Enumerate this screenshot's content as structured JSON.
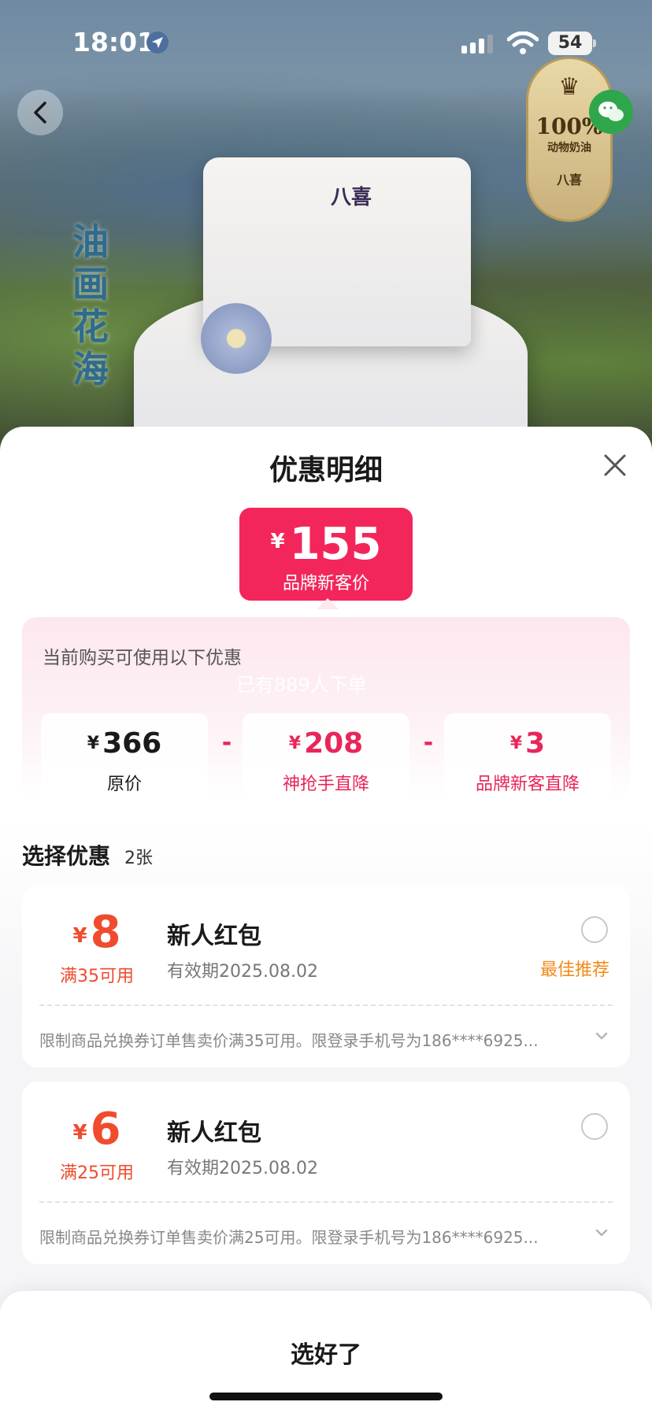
{
  "status_bar": {
    "time": "18:01",
    "battery": "54"
  },
  "hero": {
    "poem_text": "油画花海",
    "cake_logo": "八喜",
    "badge": {
      "percent": "100%",
      "subtitle": "动物奶油",
      "brand": "八喜"
    }
  },
  "sheet": {
    "title": "优惠明细",
    "price": {
      "currency": "¥",
      "amount": "155",
      "label": "品牌新客价"
    },
    "panel": {
      "hint": "当前购买可使用以下优惠",
      "watermark": "已有889人下单",
      "items": [
        {
          "currency": "¥",
          "amount": "366",
          "label": "原价"
        },
        {
          "currency": "¥",
          "amount": "208",
          "label": "神抢手直降"
        },
        {
          "currency": "¥",
          "amount": "3",
          "label": "品牌新客直降"
        }
      ],
      "operator": "-"
    },
    "section": {
      "title": "选择优惠",
      "count": "2张"
    },
    "coupons": [
      {
        "currency": "¥",
        "amount": "8",
        "condition": "满35可用",
        "name": "新人红包",
        "valid": "有效期2025.08.02",
        "tag": "最佳推荐",
        "terms": "限制商品兑换券订单售卖价满35可用。限登录手机号为186****6925..."
      },
      {
        "currency": "¥",
        "amount": "6",
        "condition": "满25可用",
        "name": "新人红包",
        "valid": "有效期2025.08.02",
        "tag": "",
        "terms": "限制商品兑换券订单售卖价满25可用。限登录手机号为186****6925..."
      }
    ],
    "confirm_label": "选好了"
  },
  "colors": {
    "price_red": "#f3265c",
    "coupon_orange": "#f04b2d",
    "best_tag": "#f08a17"
  }
}
